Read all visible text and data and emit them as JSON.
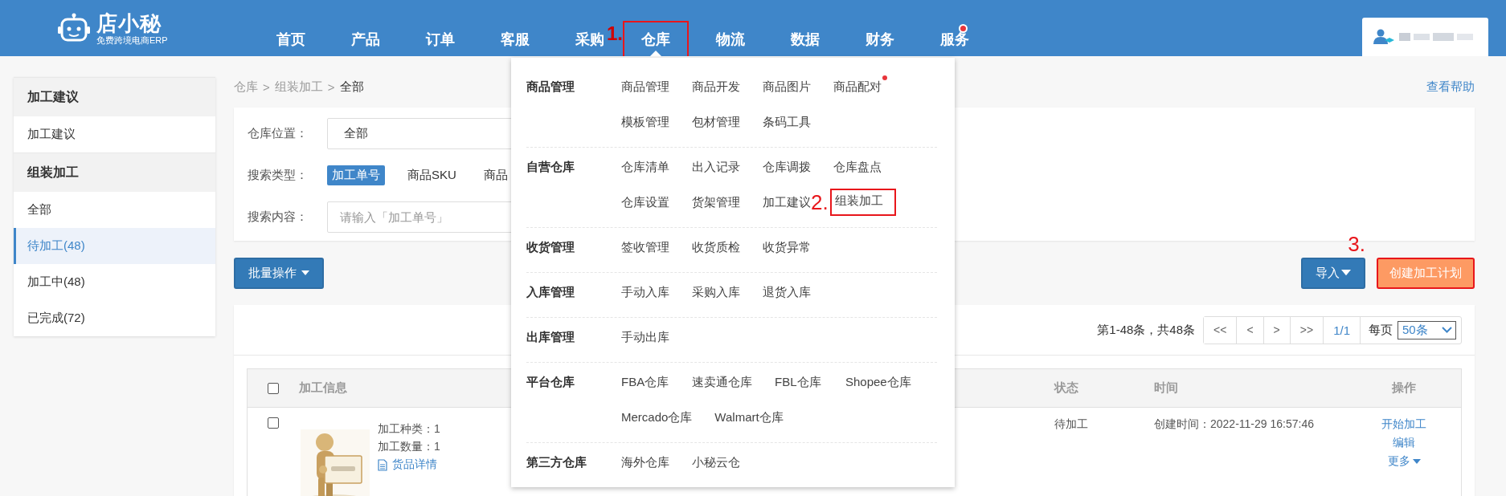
{
  "logo": {
    "name": "店小秘",
    "tagline": "免费跨境电商ERP"
  },
  "nav": [
    {
      "label": "首页",
      "selected": false,
      "highlighted": false,
      "dot": false
    },
    {
      "label": "产品",
      "selected": false,
      "highlighted": false,
      "dot": false
    },
    {
      "label": "订单",
      "selected": false,
      "highlighted": false,
      "dot": false
    },
    {
      "label": "客服",
      "selected": false,
      "highlighted": false,
      "dot": false
    },
    {
      "label": "采购",
      "selected": false,
      "highlighted": false,
      "dot": false
    },
    {
      "label": "仓库",
      "selected": true,
      "highlighted": true,
      "dot": false,
      "annotation": "1."
    },
    {
      "label": "物流",
      "selected": false,
      "highlighted": false,
      "dot": false
    },
    {
      "label": "数据",
      "selected": false,
      "highlighted": false,
      "dot": false
    },
    {
      "label": "财务",
      "selected": false,
      "highlighted": false,
      "dot": false
    },
    {
      "label": "服务",
      "selected": false,
      "highlighted": false,
      "dot": true
    }
  ],
  "sidebar": {
    "groups": [
      {
        "title": "加工建议",
        "items": [
          {
            "label": "加工建议",
            "selected": false
          }
        ]
      },
      {
        "title": "组装加工",
        "items": [
          {
            "label": "全部",
            "selected": false
          },
          {
            "label": "待加工(48)",
            "selected": true
          },
          {
            "label": "加工中(48)",
            "selected": false
          },
          {
            "label": "已完成(72)",
            "selected": false
          }
        ]
      }
    ]
  },
  "breadcrumb": {
    "items": [
      "仓库",
      "组装加工",
      "全部"
    ],
    "separator": ">"
  },
  "help_link": "查看帮助",
  "filters": [
    {
      "kind": "select",
      "label": "仓库位置：",
      "value": "全部"
    },
    {
      "kind": "chips",
      "label": "搜索类型：",
      "options": [
        {
          "label": "加工单号",
          "selected": true
        },
        {
          "label": "商品SKU",
          "selected": false
        },
        {
          "label": "商品",
          "selected": false
        }
      ]
    },
    {
      "kind": "input",
      "label": "搜索内容：",
      "placeholder": "请输入「加工单号」"
    }
  ],
  "batch_button": "批量操作",
  "import_button": "导入",
  "create_button": {
    "label": "创建加工计划",
    "highlighted": true,
    "annotation": "3."
  },
  "pagination": {
    "summary": "第1-48条，共48条",
    "buttons": [
      "<<",
      "<",
      ">",
      ">>"
    ],
    "page": "1/1",
    "per_page_label": "每页",
    "per_page": "50条"
  },
  "table": {
    "header_checked": false,
    "columns": [
      "加工信息",
      "状态",
      "时间",
      "操作"
    ],
    "rows": [
      {
        "checked": false,
        "image": {
          "kind": "picture"
        },
        "info": [
          "加工种类：1",
          "加工数量：1"
        ],
        "detail_link": "货品详情",
        "status": "待加工",
        "time": "创建时间：2022-11-29 16:57:46",
        "actions": [
          {
            "label": "开始加工",
            "dropdown": false
          },
          {
            "label": "编辑",
            "dropdown": false
          },
          {
            "label": "更多",
            "dropdown": true
          }
        ]
      }
    ]
  },
  "menu": {
    "groups": [
      {
        "title": "商品管理",
        "items": [
          {
            "label": "商品管理",
            "dot": false,
            "highlighted": false
          },
          {
            "label": "商品开发",
            "dot": false,
            "highlighted": false
          },
          {
            "label": "商品图片",
            "dot": false,
            "highlighted": false
          },
          {
            "label": "商品配对",
            "dot": true,
            "highlighted": false
          },
          {
            "label": "模板管理",
            "dot": false,
            "highlighted": false
          },
          {
            "label": "包材管理",
            "dot": false,
            "highlighted": false
          },
          {
            "label": "条码工具",
            "dot": false,
            "highlighted": false
          }
        ]
      },
      {
        "title": "自营仓库",
        "items": [
          {
            "label": "仓库清单",
            "dot": false,
            "highlighted": false
          },
          {
            "label": "出入记录",
            "dot": false,
            "highlighted": false
          },
          {
            "label": "仓库调拨",
            "dot": false,
            "highlighted": false
          },
          {
            "label": "仓库盘点",
            "dot": false,
            "highlighted": false
          },
          {
            "label": "仓库设置",
            "dot": false,
            "highlighted": false
          },
          {
            "label": "货架管理",
            "dot": false,
            "highlighted": false
          },
          {
            "label": "加工建议",
            "dot": false,
            "highlighted": false
          },
          {
            "label": "组装加工",
            "dot": false,
            "highlighted": true,
            "annotation": "2."
          }
        ]
      },
      {
        "title": "收货管理",
        "items": [
          {
            "label": "签收管理",
            "dot": false,
            "highlighted": false
          },
          {
            "label": "收货质检",
            "dot": false,
            "highlighted": false
          },
          {
            "label": "收货异常",
            "dot": false,
            "highlighted": false
          }
        ]
      },
      {
        "title": "入库管理",
        "items": [
          {
            "label": "手动入库",
            "dot": false,
            "highlighted": false
          },
          {
            "label": "采购入库",
            "dot": false,
            "highlighted": false
          },
          {
            "label": "退货入库",
            "dot": false,
            "highlighted": false
          }
        ]
      },
      {
        "title": "出库管理",
        "items": [
          {
            "label": "手动出库",
            "dot": false,
            "highlighted": false
          }
        ]
      },
      {
        "title": "平台仓库",
        "items": [
          {
            "label": "FBA仓库",
            "dot": false,
            "highlighted": false
          },
          {
            "label": "速卖通仓库",
            "dot": false,
            "highlighted": false
          },
          {
            "label": "FBL仓库",
            "dot": false,
            "highlighted": false
          },
          {
            "label": "Shopee仓库",
            "dot": false,
            "highlighted": false
          },
          {
            "label": "Mercado仓库",
            "dot": false,
            "highlighted": false
          },
          {
            "label": "Walmart仓库",
            "dot": false,
            "highlighted": false
          }
        ]
      },
      {
        "title": "第三方仓库",
        "items": [
          {
            "label": "海外仓库",
            "dot": false,
            "highlighted": false
          },
          {
            "label": "小秘云仓",
            "dot": false,
            "highlighted": false
          }
        ]
      }
    ]
  }
}
